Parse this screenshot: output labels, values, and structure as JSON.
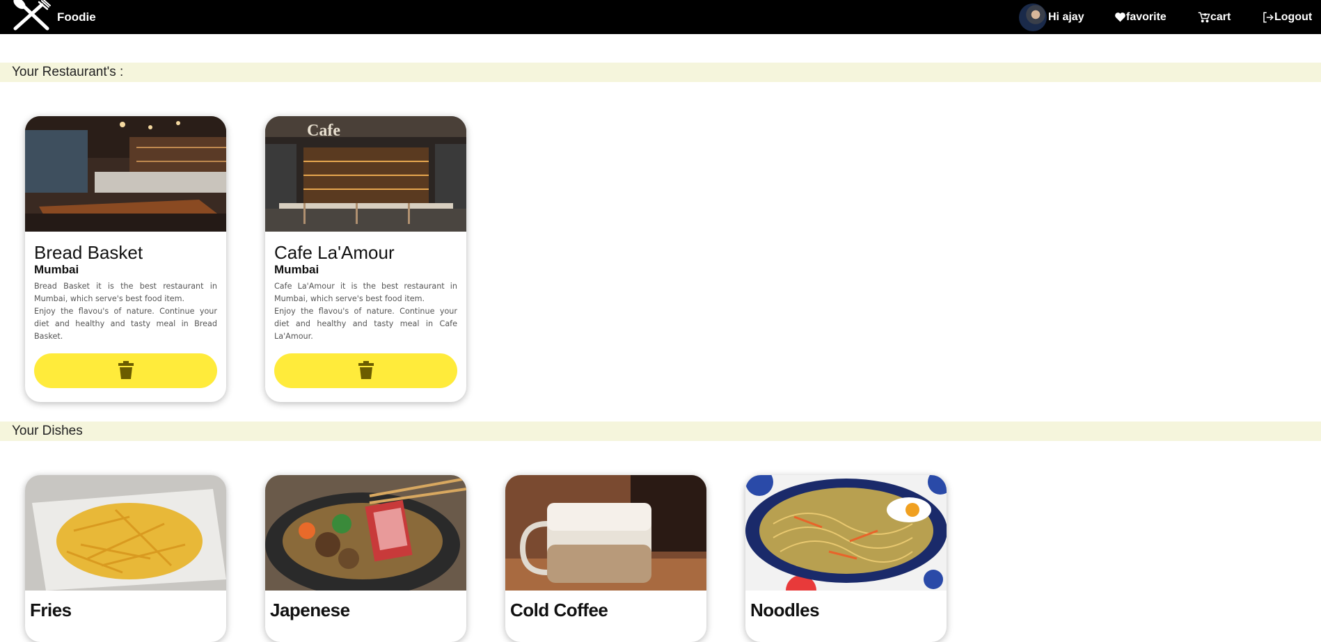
{
  "navbar": {
    "brand": "Foodie",
    "greeting": "Hi ajay",
    "favorite": "favorite",
    "cart": "cart",
    "logout": "Logout"
  },
  "restaurants_section": {
    "title": "Your Restaurant's :",
    "items": [
      {
        "name": "Bread Basket",
        "city": "Mumbai",
        "desc1": "Bread Basket it is the best restaurant in Mumbai, which serve's best food item.",
        "desc2": "Enjoy the flavou's of nature. Continue your diet and healthy and tasty meal in Bread Basket."
      },
      {
        "name": "Cafe La'Amour",
        "city": "Mumbai",
        "desc1": "Cafe La'Amour it is the best restaurant in Mumbai, which serve's best food item.",
        "desc2": "Enjoy the flavou's of nature. Continue your diet and healthy and tasty meal in Cafe La'Amour."
      }
    ]
  },
  "dishes_section": {
    "title": "Your Dishes",
    "items": [
      {
        "name": "Fries"
      },
      {
        "name": "Japenese"
      },
      {
        "name": "Cold Coffee"
      },
      {
        "name": "Noodles"
      }
    ]
  },
  "colors": {
    "navbar": "#000000",
    "section_bar": "#f5f5dc",
    "delete_button": "#ffeb3b",
    "delete_icon": "#6b5c00"
  }
}
